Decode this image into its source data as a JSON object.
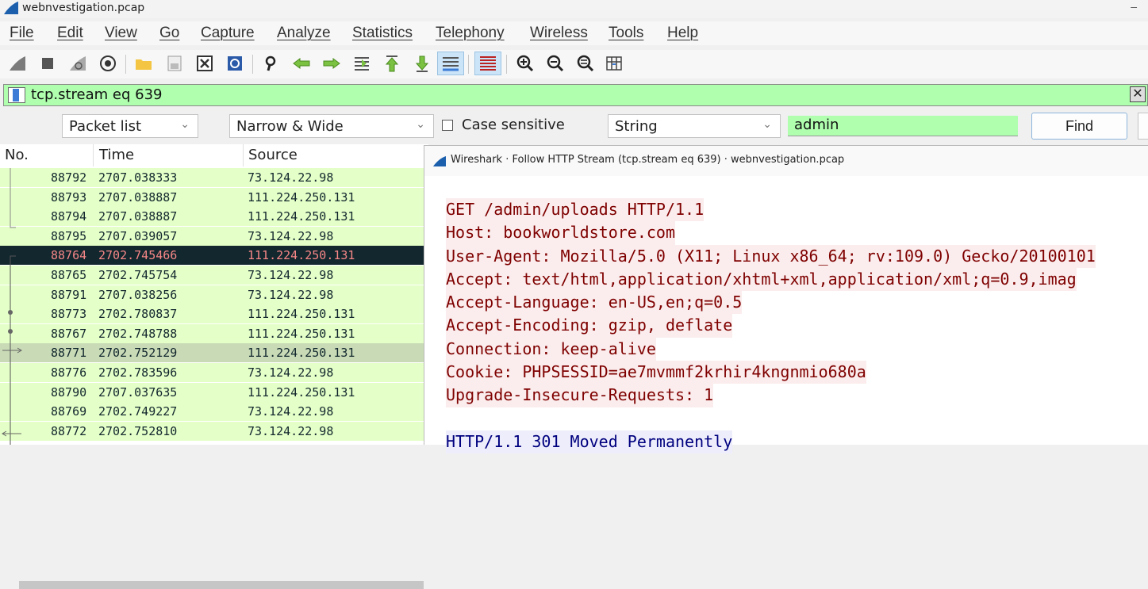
{
  "window": {
    "title": "webnvestigation.pcap",
    "minimize": "–"
  },
  "menu": [
    "File",
    "Edit",
    "View",
    "Go",
    "Capture",
    "Analyze",
    "Statistics",
    "Telephony",
    "Wireless",
    "Tools",
    "Help"
  ],
  "filter": {
    "value": "tcp.stream eq 639",
    "clear_glyph": "✕"
  },
  "find": {
    "scope": "Packet list",
    "char_width": "Narrow & Wide",
    "case_sensitive_label": "Case sensitive",
    "case_sensitive_checked": false,
    "type": "String",
    "query": "admin",
    "find_button": "Find"
  },
  "packet_list": {
    "columns": [
      "No.",
      "Time",
      "Source"
    ],
    "rows": [
      {
        "no": "88792",
        "time": "2707.038333",
        "src": "73.124.22.98",
        "state": "normal"
      },
      {
        "no": "88793",
        "time": "2707.038887",
        "src": "111.224.250.131",
        "state": "normal"
      },
      {
        "no": "88794",
        "time": "2707.038887",
        "src": "111.224.250.131",
        "state": "normal"
      },
      {
        "no": "88795",
        "time": "2707.039057",
        "src": "73.124.22.98",
        "state": "normal"
      },
      {
        "no": "88764",
        "time": "2702.745466",
        "src": "111.224.250.131",
        "state": "selected"
      },
      {
        "no": "88765",
        "time": "2702.745754",
        "src": "73.124.22.98",
        "state": "normal"
      },
      {
        "no": "88791",
        "time": "2707.038256",
        "src": "73.124.22.98",
        "state": "normal"
      },
      {
        "no": "88773",
        "time": "2702.780837",
        "src": "111.224.250.131",
        "state": "normal"
      },
      {
        "no": "88767",
        "time": "2702.748788",
        "src": "111.224.250.131",
        "state": "normal"
      },
      {
        "no": "88771",
        "time": "2702.752129",
        "src": "111.224.250.131",
        "state": "related"
      },
      {
        "no": "88776",
        "time": "2702.783596",
        "src": "73.124.22.98",
        "state": "normal"
      },
      {
        "no": "88790",
        "time": "2707.037635",
        "src": "111.224.250.131",
        "state": "normal"
      },
      {
        "no": "88769",
        "time": "2702.749227",
        "src": "73.124.22.98",
        "state": "normal"
      },
      {
        "no": "88772",
        "time": "2702.752810",
        "src": "73.124.22.98",
        "state": "normal"
      }
    ]
  },
  "follow_stream": {
    "title": "Wireshark · Follow HTTP Stream (tcp.stream eq 639) · webnvestigation.pcap",
    "request_lines": [
      "GET /admin/uploads HTTP/1.1",
      "Host: bookworldstore.com",
      "User-Agent: Mozilla/5.0 (X11; Linux x86_64; rv:109.0) Gecko/20100101",
      "Accept: text/html,application/xhtml+xml,application/xml;q=0.9,imag",
      "Accept-Language: en-US,en;q=0.5",
      "Accept-Encoding: gzip, deflate",
      "Connection: keep-alive",
      "Cookie: PHPSESSID=ae7mvmmf2krhir4kngnmio680a",
      "Upgrade-Insecure-Requests: 1"
    ],
    "response_lines": [
      "HTTP/1.1 301 Moved Permanently"
    ]
  },
  "colors": {
    "filter_ok": "#afffaf",
    "row_tcp": "#e4ffc7",
    "row_selected_bg": "#12272e",
    "row_selected_fg": "#f78787",
    "client_text": "#7f0000",
    "client_bg": "#fbeded",
    "server_text": "#00007f",
    "server_bg": "#ededfb"
  }
}
